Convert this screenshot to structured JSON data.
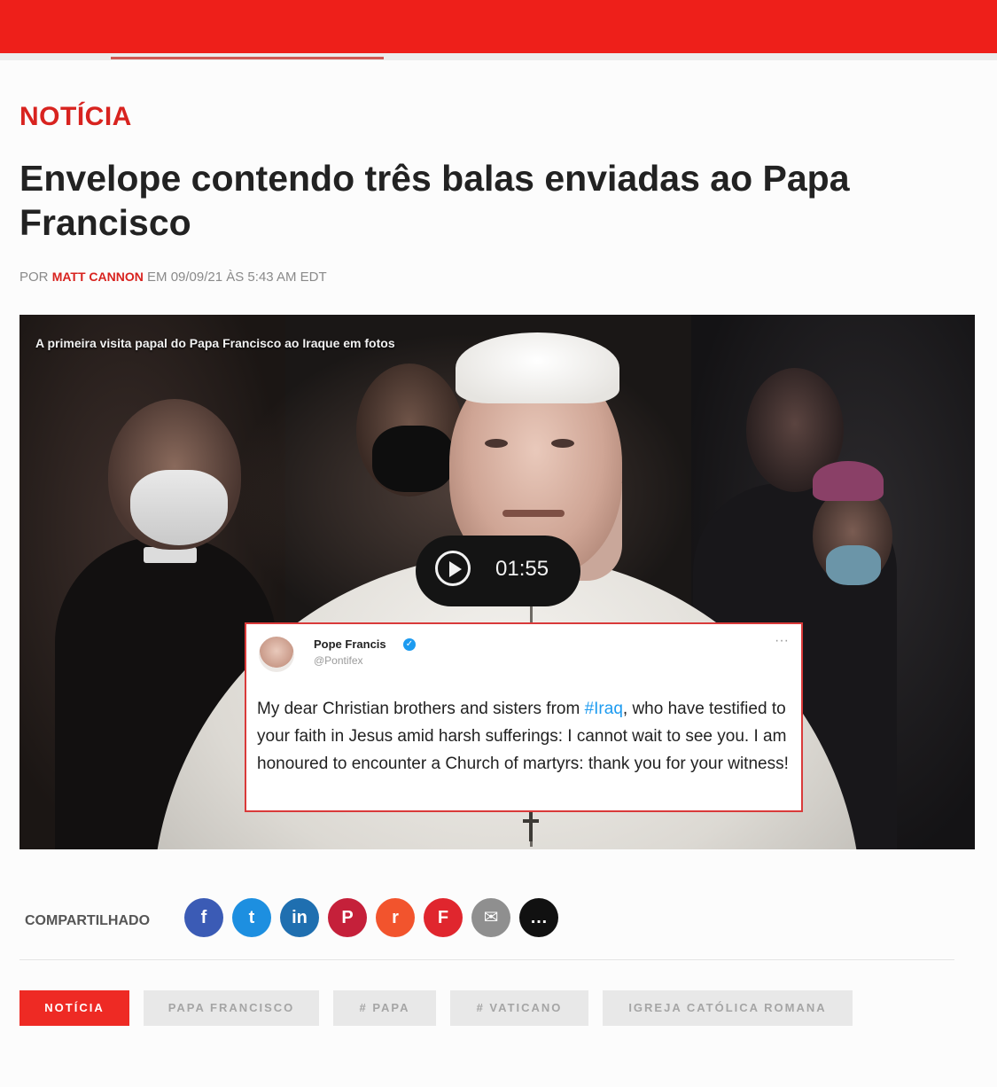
{
  "article": {
    "section_label": "NOTÍCIA",
    "headline": "Envelope contendo três balas enviadas ao Papa Francisco",
    "byline": {
      "prefix": "POR",
      "author": "Matt Cannon",
      "meta": "EM 09/09/21 ÀS 5:43 AM EDT"
    }
  },
  "video": {
    "caption": "A primeira visita papal do Papa Francisco ao Iraque em fotos",
    "duration": "01:55",
    "play_icon": "play-circle-icon"
  },
  "tweet": {
    "author_name": "Pope Francis",
    "handle": "@Pontifex",
    "verified_glyph": "✓",
    "more_glyph": "···",
    "text_before_hashtag": "My dear Christian brothers and sisters from ",
    "hashtag": "#Iraq",
    "text_after_hashtag": ", who have testified to your faith in Jesus amid harsh sufferings: I cannot wait to see you. I am honoured to encounter a Church of martyrs: thank you for your witness!"
  },
  "share": {
    "label": "COMPARTILHADO",
    "buttons": [
      {
        "name": "facebook",
        "glyph": "f",
        "color": "#3b5bb5"
      },
      {
        "name": "twitter",
        "glyph": "t",
        "color": "#1d8fe0"
      },
      {
        "name": "linkedin",
        "glyph": "in",
        "color": "#1f6fb0"
      },
      {
        "name": "pinterest",
        "glyph": "P",
        "color": "#c5203a"
      },
      {
        "name": "reddit",
        "glyph": "r",
        "color": "#f2542d"
      },
      {
        "name": "flipboard",
        "glyph": "F",
        "color": "#e0262e"
      },
      {
        "name": "email",
        "glyph": "✉",
        "color": "#8f8f8f"
      },
      {
        "name": "sms",
        "glyph": "…",
        "color": "#111111"
      }
    ]
  },
  "tags": [
    {
      "label": "NOTÍCIA",
      "primary": true
    },
    {
      "label": "PAPA FRANCISCO",
      "primary": false
    },
    {
      "label": "# PAPA",
      "primary": false
    },
    {
      "label": "# VATICANO",
      "primary": false
    },
    {
      "label": "IGREJA CATÓLICA ROMANA",
      "primary": false
    }
  ],
  "colors": {
    "brand_red": "#ee1f1a",
    "section_red": "#d8231f",
    "hashtag_blue": "#1d9bf0"
  }
}
